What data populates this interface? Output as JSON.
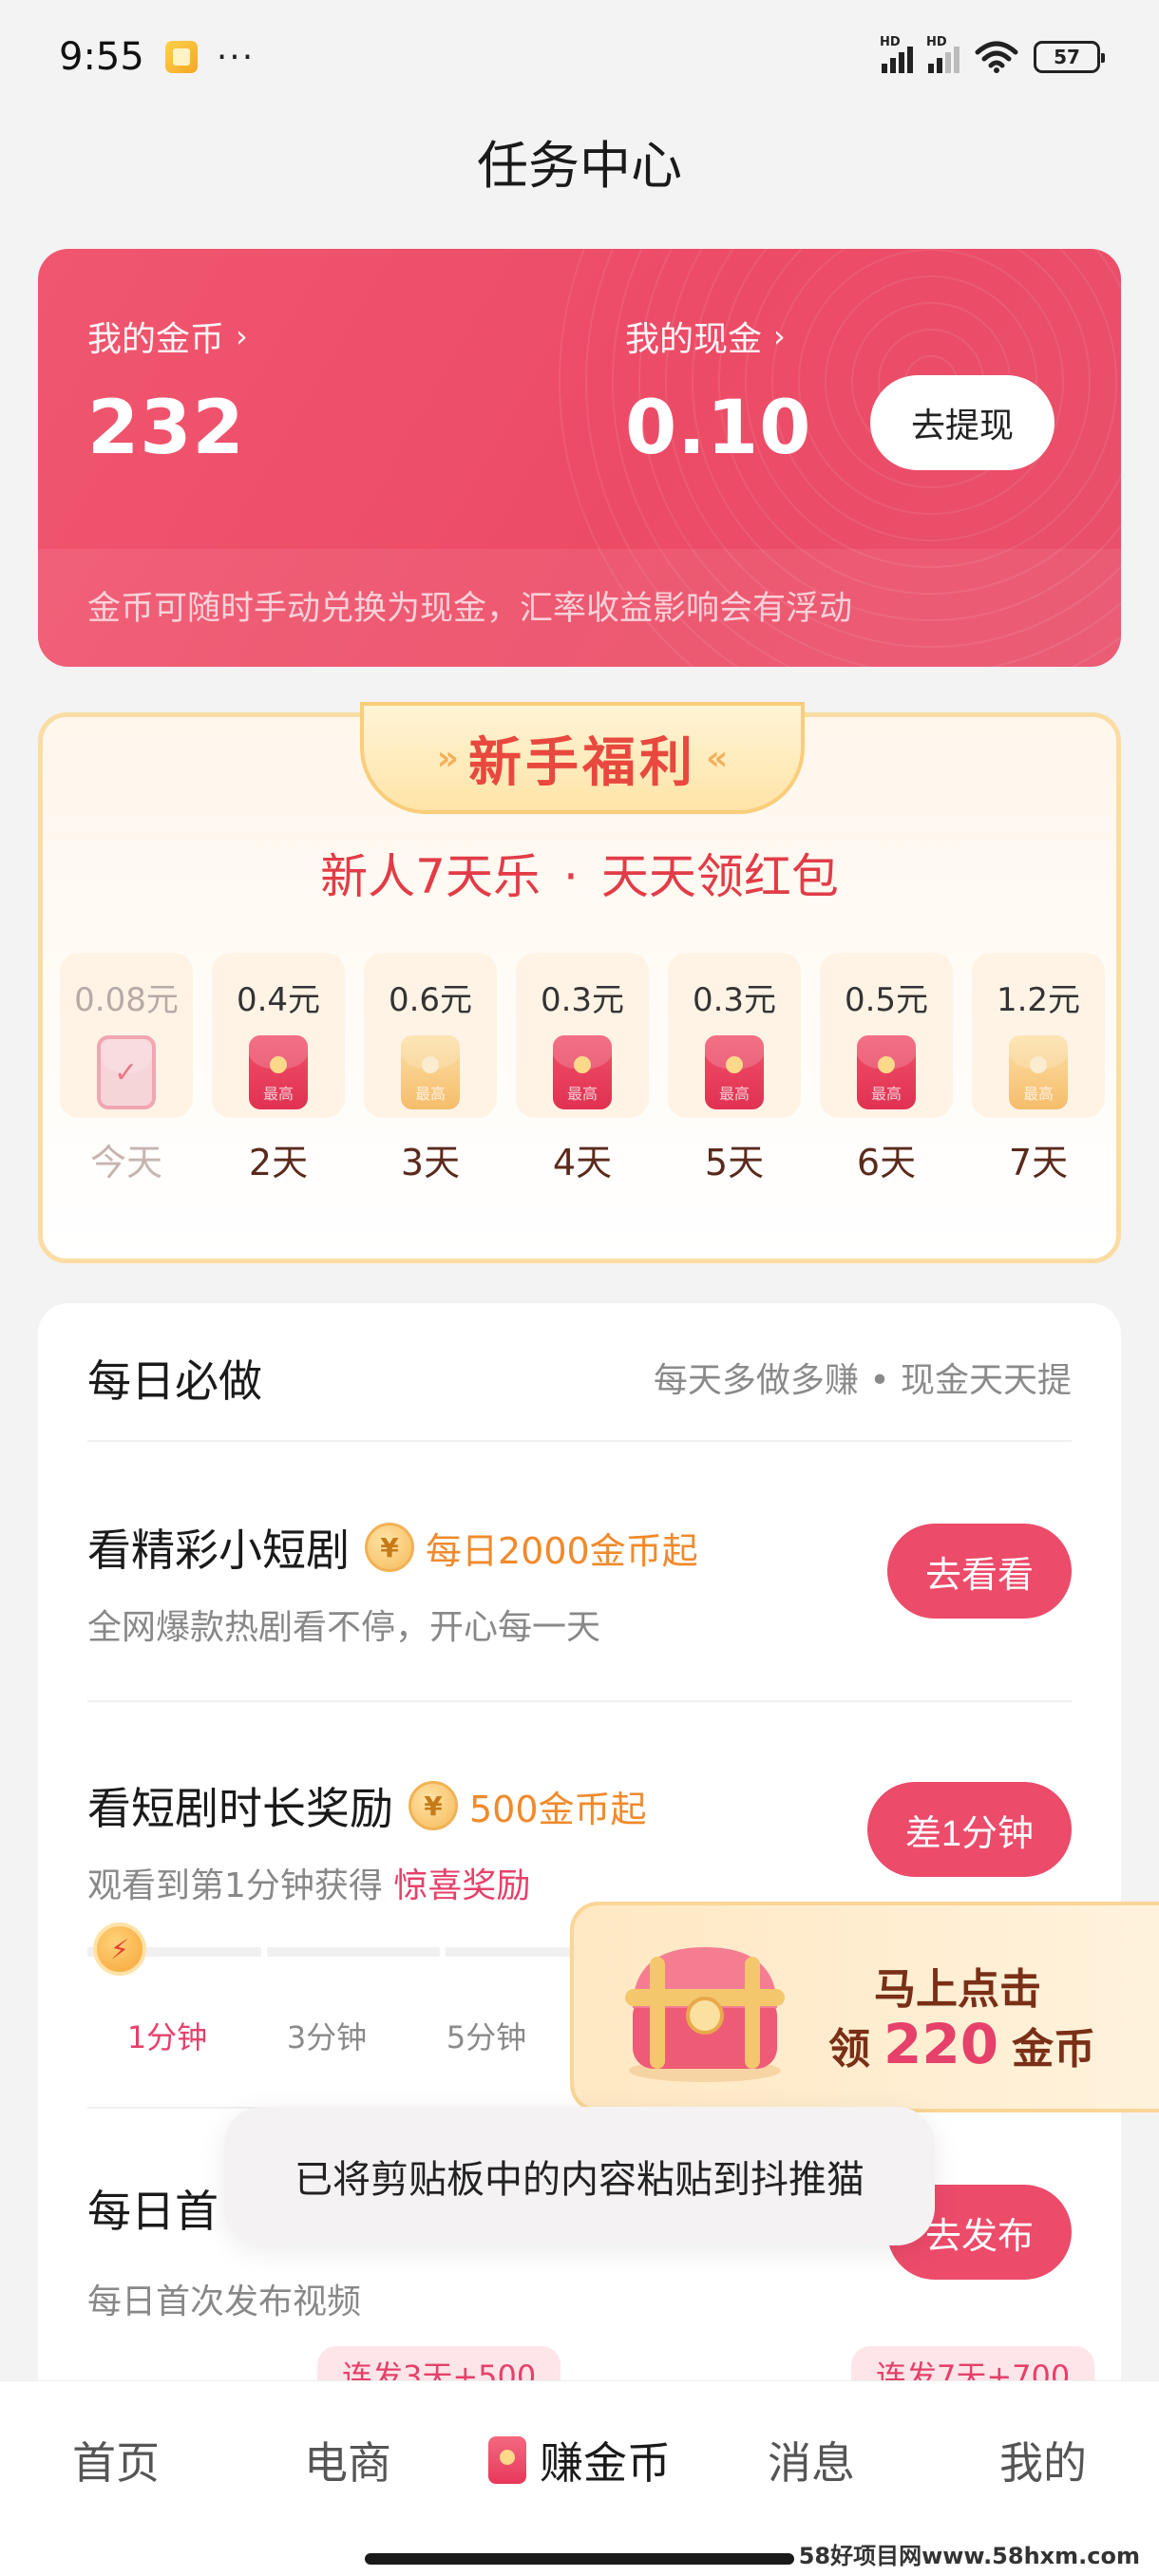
{
  "status_bar": {
    "time": "9:55",
    "more": "···",
    "hd1": "HD",
    "hd2": "HD",
    "battery": "57"
  },
  "page": {
    "title": "任务中心"
  },
  "coins": {
    "gold_label": "我的金币",
    "gold_value": "232",
    "cash_label": "我的现金",
    "cash_value": "0.10",
    "withdraw_label": "去提现",
    "note": "金币可随时手动兑换为现金，汇率收益影响会有浮动"
  },
  "welfare": {
    "ribbon": "新手福利",
    "subtitle_left": "新人7天乐",
    "subtitle_dot": "·",
    "subtitle_right": "天天领红包",
    "envelope_text": "最高",
    "days": [
      {
        "amount": "0.08元",
        "label": "今天",
        "style": "done"
      },
      {
        "amount": "0.4元",
        "label": "2天",
        "style": "red"
      },
      {
        "amount": "0.6元",
        "label": "3天",
        "style": "gold"
      },
      {
        "amount": "0.3元",
        "label": "4天",
        "style": "red"
      },
      {
        "amount": "0.3元",
        "label": "5天",
        "style": "red"
      },
      {
        "amount": "0.5元",
        "label": "6天",
        "style": "red"
      },
      {
        "amount": "1.2元",
        "label": "7天",
        "style": "gold"
      }
    ]
  },
  "daily": {
    "title": "每日必做",
    "hint": "每天多做多赚 • 现金天天提",
    "coin_symbol": "¥",
    "tasks": [
      {
        "title": "看精彩小短剧",
        "reward": "每日2000金币起",
        "desc": "全网爆款热剧看不停，开心每一天",
        "button": "去看看"
      },
      {
        "title": "看短剧时长奖励",
        "reward": "500金币起",
        "desc": "观看到第1分钟获得",
        "desc_highlight": "惊喜奖励",
        "button": "差1分钟"
      },
      {
        "title": "每日首",
        "desc": "每日首次发布视频",
        "button": "去发布"
      }
    ],
    "progress_value": 0.05,
    "progress_knob": "⚡",
    "progress_labels": [
      "1分钟",
      "3分钟",
      "5分钟"
    ],
    "streaks": [
      "连发3天+500",
      "连发7天+700"
    ]
  },
  "promo": {
    "line1": "马上点击",
    "line2_prefix": "领",
    "line2_amount": "220",
    "line2_suffix": "金币"
  },
  "toast": {
    "text": "已将剪贴板中的内容粘贴到抖推猫"
  },
  "nav": {
    "items": [
      "首页",
      "电商",
      "赚金币",
      "消息",
      "我的"
    ]
  },
  "watermark": "58好项目网www.58hxm.com",
  "colors": {
    "accent": "#ec4b6a",
    "reward_orange": "#f08a2c",
    "card_red": "#ee506b"
  }
}
